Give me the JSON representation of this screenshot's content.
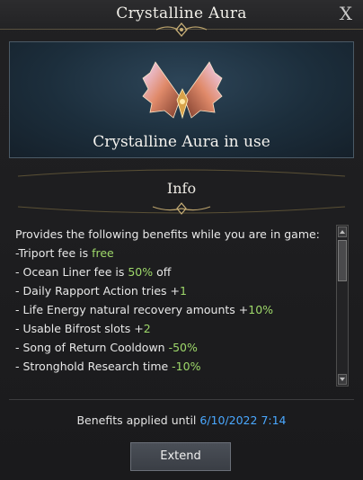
{
  "window": {
    "title": "Crystalline Aura",
    "close_label": "X"
  },
  "banner": {
    "status_text": "Crystalline Aura in use",
    "icon": "crystalline-wings-icon"
  },
  "info": {
    "title": "Info",
    "intro": "Provides the following benefits while you are in game:",
    "benefits": [
      {
        "text": "-Triport fee is ",
        "highlight": "free",
        "suffix": ""
      },
      {
        "text": "- Ocean Liner fee is ",
        "highlight": "50%",
        "suffix": " off"
      },
      {
        "text": "- Daily Rapport Action tries +",
        "highlight": "1",
        "suffix": ""
      },
      {
        "text": "- Life Energy natural recovery amounts +",
        "highlight": "10%",
        "suffix": ""
      },
      {
        "text": "- Usable Bifrost slots +",
        "highlight": "2",
        "suffix": ""
      },
      {
        "text": "- Song of Return Cooldown ",
        "highlight": "-50%",
        "suffix": ""
      },
      {
        "text": "- Stronghold Research time ",
        "highlight": "-10%",
        "suffix": ""
      }
    ]
  },
  "footer": {
    "until_label": "Benefits applied until ",
    "until_date": "6/10/2022 7:14",
    "extend_label": "Extend"
  },
  "colors": {
    "highlight": "#9ed86a",
    "date": "#4aa8ff",
    "gold_accent": "#b8a06a"
  }
}
